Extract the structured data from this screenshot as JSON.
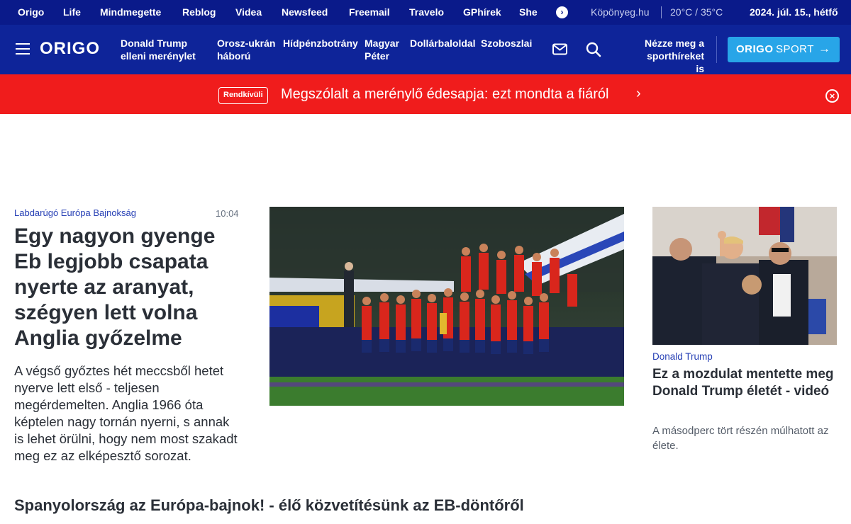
{
  "network_bar": {
    "links": [
      "Origo",
      "Life",
      "Mindmegette",
      "Reblog",
      "Videa",
      "Newsfeed",
      "Freemail",
      "Travelo",
      "GPhírek",
      "She"
    ],
    "more_icon": "chevron-right-icon",
    "weather_link": "Köpönyeg.hu",
    "temperature": "20°C / 35°C",
    "date": "2024. júl. 15., hétfő"
  },
  "header": {
    "logo": "ORIGO",
    "nav": [
      {
        "line1": "Donald Trump",
        "line2": "elleni merénylet"
      },
      {
        "line1": "Orosz-ukrán",
        "line2": "háború"
      },
      {
        "line1": "Hídpénzbotrány",
        "line2": ""
      },
      {
        "line1": "Magyar",
        "line2": "Péter"
      },
      {
        "line1": "Dollárbaloldal",
        "line2": ""
      },
      {
        "line1": "Szoboszlai",
        "line2": ""
      }
    ],
    "sport_promo": {
      "line1": "Nézze meg a",
      "line2": "sporthíreket is"
    },
    "sport_button": {
      "brand": "ORIGO",
      "section": "SPORT",
      "arrow": "→"
    },
    "colors": {
      "top": "#0a1a8a",
      "main": "#0e2499",
      "sport": "#28a5e8"
    }
  },
  "breaking": {
    "badge": "Rendkívüli",
    "headline": "Megszólalt a merénylő édesapja: ezt mondta a fiáról",
    "chevron": "›",
    "close": "×",
    "color": "#f01c1c"
  },
  "lead_article": {
    "category": "Labdarúgó Európa Bajnokság",
    "time": "10:04",
    "title": "Egy nagyon gyenge Eb legjobb csapata nyerte az aranyat, szégyen lett volna Anglia győzelme",
    "lede": "A végső győztes hét meccsből hetet nyerve lett első - teljesen megérdemelten. Anglia 1966 óta képtelen nagy tornán nyerni, s annak is lehet örülni, hogy nem most szakadt meg ez az elképesztő sorozat."
  },
  "side_article": {
    "category": "Donald Trump",
    "title": "Ez a mozdulat mentette meg Donald Trump életét - videó",
    "lede": "A másodperc tört részén múlhatott az élete."
  },
  "bottom_headline": "Spanyolország az Európa-bajnok! - élő közvetítésünk az EB-döntőről"
}
